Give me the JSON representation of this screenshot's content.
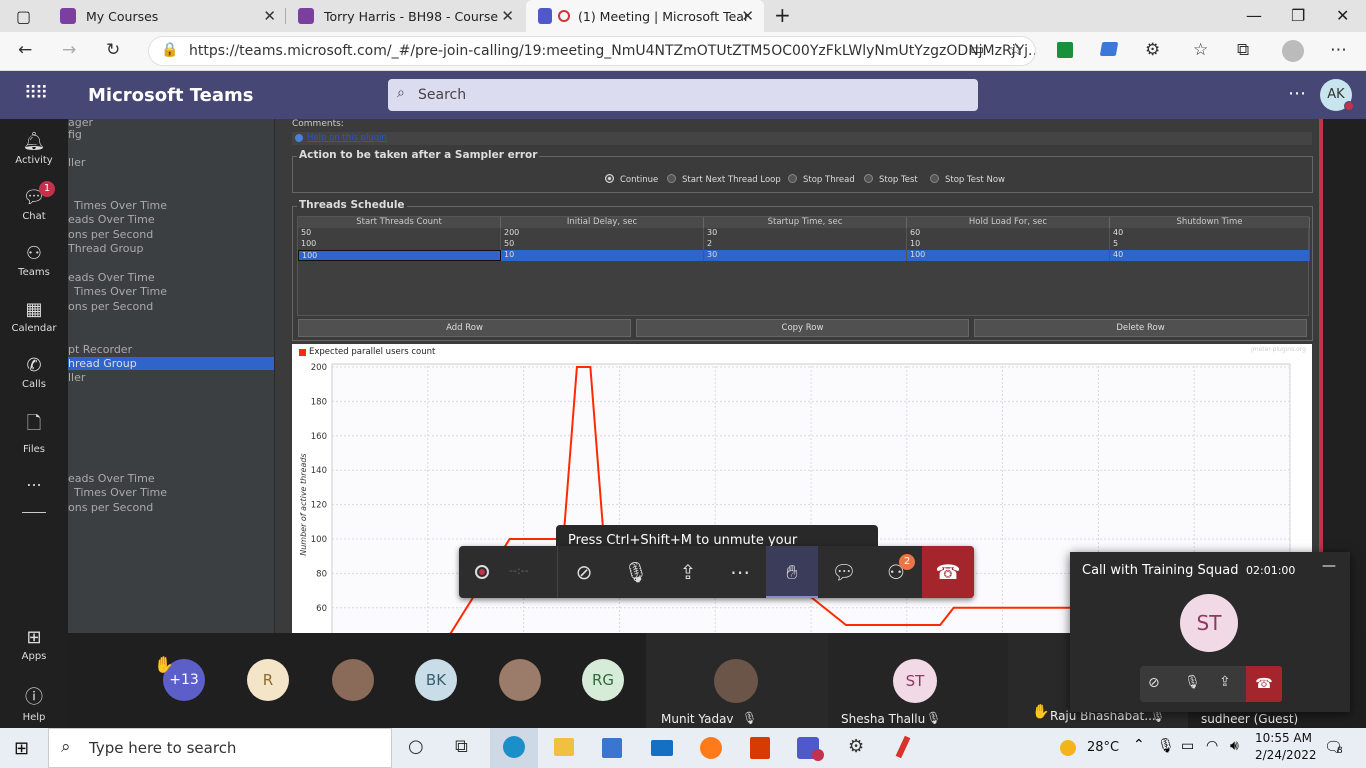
{
  "browser": {
    "tabs": [
      {
        "title": "My Courses",
        "active": false
      },
      {
        "title": "Torry Harris - BH98 - Course",
        "active": false
      },
      {
        "title": "(1) Meeting | Microsoft Tear",
        "active": true
      }
    ],
    "url": "https://teams.microsoft.com/_#/pre-join-calling/19:meeting_NmU4NTZmOTUtZTM5OC00YzFkLWlyNmUtYzgzODNjMzRjYj..."
  },
  "teams": {
    "title": "Microsoft Teams",
    "search_placeholder": "Search",
    "user_initials": "AK",
    "rail": [
      {
        "label": "Activity",
        "icon": "bell-icon",
        "badge": ""
      },
      {
        "label": "Chat",
        "icon": "chat-icon",
        "badge": "1"
      },
      {
        "label": "Teams",
        "icon": "teams-icon",
        "badge": ""
      },
      {
        "label": "Calendar",
        "icon": "calendar-icon",
        "badge": ""
      },
      {
        "label": "Calls",
        "icon": "phone-icon",
        "badge": ""
      },
      {
        "label": "Files",
        "icon": "file-icon",
        "badge": ""
      },
      {
        "label": "...",
        "icon": "more-icon",
        "badge": ""
      },
      {
        "label": "Apps",
        "icon": "apps-icon",
        "badge": ""
      },
      {
        "label": "Help",
        "icon": "help-icon",
        "badge": ""
      }
    ]
  },
  "jmeter": {
    "tree": [
      "ager",
      "fig",
      "ller",
      "Times Over Time",
      "eads Over Time",
      "ons per Second",
      "Thread Group",
      "eads Over Time",
      "Times Over Time",
      "ons per Second",
      "pt Recorder",
      "hread Group",
      "ller",
      "eads Over Time",
      "Times Over Time",
      "ons per Second"
    ],
    "comments_label": "Comments:",
    "help_link": "Help on this plugin",
    "sampler_error": {
      "legend": "Action to be taken after a Sampler error",
      "options": [
        "Continue",
        "Start Next Thread Loop",
        "Stop Thread",
        "Stop Test",
        "Stop Test Now"
      ],
      "selected": "Continue"
    },
    "schedule": {
      "legend": "Threads Schedule",
      "columns": [
        "Start Threads Count",
        "Initial Delay, sec",
        "Startup Time, sec",
        "Hold Load For, sec",
        "Shutdown Time"
      ],
      "rows": [
        [
          "50",
          "200",
          "30",
          "60",
          "40"
        ],
        [
          "100",
          "50",
          "2",
          "10",
          "5"
        ],
        [
          "100",
          "10",
          "30",
          "100",
          "40"
        ]
      ],
      "buttons": [
        "Add Row",
        "Copy Row",
        "Delete Row"
      ]
    }
  },
  "chart_data": {
    "type": "line",
    "legend": "Expected parallel users count",
    "watermark": "jmeter-plugins.org",
    "ylabel": "Number of active threads",
    "yticks": [
      60,
      80,
      100,
      120,
      140,
      160,
      180,
      200
    ],
    "ylim": [
      50,
      200
    ],
    "series": [
      {
        "name": "Expected parallel users count",
        "color": "#ff2a00",
        "points": [
          [
            0,
            0
          ],
          [
            8,
            100
          ],
          [
            12,
            100
          ],
          [
            13,
            200
          ],
          [
            14,
            200
          ],
          [
            15,
            100
          ],
          [
            25,
            100
          ],
          [
            33,
            50
          ],
          [
            40,
            50
          ],
          [
            41,
            60
          ],
          [
            55,
            60
          ]
        ]
      }
    ]
  },
  "meeting": {
    "tooltip": "Press Ctrl+Shift+M to unmute your microphone.",
    "timer": "--:--",
    "people_badge": "2",
    "participants": [
      {
        "initials": "+13",
        "color": "#5b5fc7"
      },
      {
        "initials": "R",
        "color": "#f5e5c8"
      },
      {
        "initials": "",
        "color": "#8a6b5a"
      },
      {
        "initials": "BK",
        "color": "#c8dde8"
      },
      {
        "initials": "",
        "color": "#9b7b6a"
      },
      {
        "initials": "RG",
        "color": "#d6ecd8"
      }
    ],
    "speakers": [
      {
        "name": "Munit Yadav"
      },
      {
        "name": "Shesha Thallu",
        "initials": "ST"
      },
      {
        "name": "Raju Bhashabat..."
      },
      {
        "name": "sudheer (Guest)"
      }
    ],
    "call_popup": {
      "title": "Call with Training Squad",
      "time": "02:01:00",
      "initials": "ST"
    }
  },
  "taskbar": {
    "search_placeholder": "Type here to search",
    "weather": "28°C",
    "time": "10:55 AM",
    "date": "2/24/2022",
    "notif_count": "8"
  }
}
